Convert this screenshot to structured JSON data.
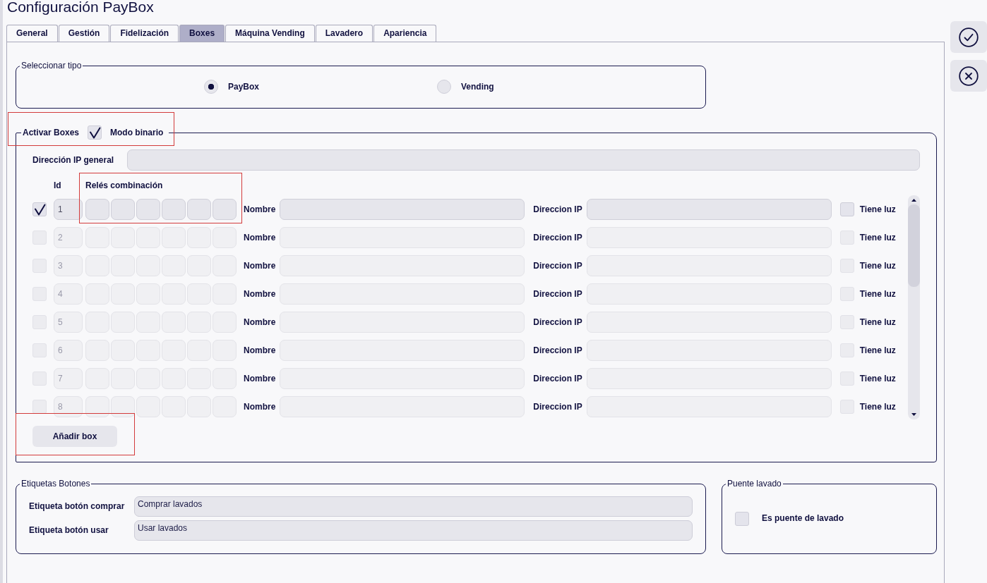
{
  "window": {
    "title": "Configuración PayBox"
  },
  "tabs": [
    {
      "label": "General",
      "selected": false
    },
    {
      "label": "Gestión",
      "selected": false
    },
    {
      "label": "Fidelización",
      "selected": false
    },
    {
      "label": "Boxes",
      "selected": true
    },
    {
      "label": "Máquina Vending",
      "selected": false
    },
    {
      "label": "Lavadero",
      "selected": false
    },
    {
      "label": "Apariencia",
      "selected": false
    }
  ],
  "actions": [
    {
      "kind": "confirm"
    },
    {
      "kind": "cancel"
    }
  ],
  "type_selector": {
    "legend": "Seleccionar tipo",
    "options": [
      {
        "label": "PayBox",
        "selected": true
      },
      {
        "label": "Vending",
        "selected": false
      }
    ]
  },
  "boxes_section": {
    "legend": "Activar Boxes",
    "highlighted": true,
    "binary_mode": {
      "label": "Modo binario",
      "checked": true
    },
    "general_ip": {
      "label": "Dirección IP general"
    },
    "columns": {
      "id": "Id",
      "relays": "Relés combinación",
      "relays_highlighted": true
    },
    "rows": [
      {
        "checked": true,
        "id": "1",
        "name_label": "Nombre",
        "ip_label": "Direccion IP",
        "light_label": "Tiene luz",
        "light_checked": false
      },
      {
        "checked": false,
        "id": "2",
        "name_label": "Nombre",
        "ip_label": "Direccion IP",
        "light_label": "Tiene luz",
        "light_checked": false
      },
      {
        "checked": false,
        "id": "3",
        "name_label": "Nombre",
        "ip_label": "Direccion IP",
        "light_label": "Tiene luz",
        "light_checked": false
      },
      {
        "checked": false,
        "id": "4",
        "name_label": "Nombre",
        "ip_label": "Direccion IP",
        "light_label": "Tiene luz",
        "light_checked": false
      },
      {
        "checked": false,
        "id": "5",
        "name_label": "Nombre",
        "ip_label": "Direccion IP",
        "light_label": "Tiene luz",
        "light_checked": false
      },
      {
        "checked": false,
        "id": "6",
        "name_label": "Nombre",
        "ip_label": "Direccion IP",
        "light_label": "Tiene luz",
        "light_checked": false
      },
      {
        "checked": false,
        "id": "7",
        "name_label": "Nombre",
        "ip_label": "Direccion IP",
        "light_label": "Tiene luz",
        "light_checked": false
      },
      {
        "checked": false,
        "id": "8",
        "name_label": "Nombre",
        "ip_label": "Direccion IP",
        "light_label": "Tiene luz",
        "light_checked": false
      }
    ],
    "add_button": {
      "label": "Añadir box",
      "highlighted": true
    }
  },
  "button_labels": {
    "legend": "Etiquetas Botones",
    "fields": [
      {
        "label": "Etiqueta botón comprar",
        "value": "Comprar lavados"
      },
      {
        "label": "Etiqueta botón usar",
        "value": "Usar lavados"
      }
    ]
  },
  "wash_bridge": {
    "legend": "Puente lavado",
    "option": {
      "label": "Es puente de lavado",
      "checked": false
    }
  }
}
